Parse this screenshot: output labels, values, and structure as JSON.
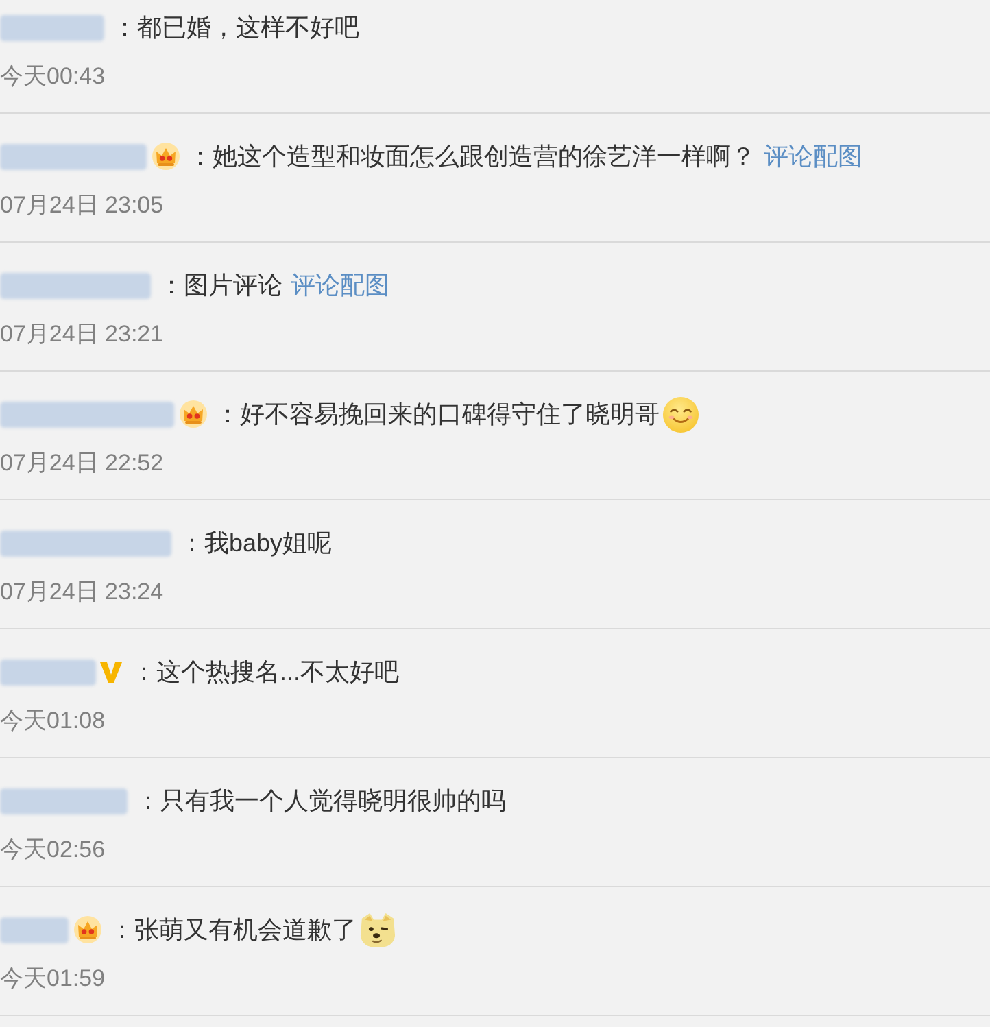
{
  "comments": [
    {
      "crown": false,
      "verified": false,
      "separator": "：",
      "content": [
        {
          "kind": "text",
          "text": "都已婚，这样不好吧"
        }
      ],
      "time": "今天00:43"
    },
    {
      "crown": true,
      "verified": false,
      "separator": "：",
      "content": [
        {
          "kind": "text",
          "text": "她这个造型和妆面怎么跟创造营的徐艺洋一样啊？"
        },
        {
          "kind": "link",
          "text": "评论配图"
        }
      ],
      "time": "07月24日 23:05"
    },
    {
      "crown": false,
      "verified": false,
      "separator": "：",
      "content": [
        {
          "kind": "text",
          "text": "图片评论"
        },
        {
          "kind": "link",
          "text": "评论配图"
        }
      ],
      "time": "07月24日 23:21"
    },
    {
      "crown": true,
      "verified": false,
      "separator": "：",
      "content": [
        {
          "kind": "text",
          "text": "好不容易挽回来的口碑得守住了晓明哥"
        },
        {
          "kind": "smile"
        }
      ],
      "time": "07月24日 22:52"
    },
    {
      "crown": false,
      "verified": false,
      "separator": "：",
      "content": [
        {
          "kind": "text",
          "text": "我baby姐呢"
        }
      ],
      "time": "07月24日 23:24"
    },
    {
      "crown": false,
      "verified": true,
      "separator": "：",
      "content": [
        {
          "kind": "text",
          "text": "这个热搜名...不太好吧"
        }
      ],
      "time": "今天01:08"
    },
    {
      "crown": false,
      "verified": false,
      "separator": "：",
      "content": [
        {
          "kind": "text",
          "text": "只有我一个人觉得晓明很帅的吗"
        }
      ],
      "time": "今天02:56"
    },
    {
      "crown": true,
      "verified": false,
      "separator": "：",
      "content": [
        {
          "kind": "text",
          "text": "张萌又有机会道歉了"
        },
        {
          "kind": "doge"
        }
      ],
      "time": "今天01:59"
    }
  ]
}
